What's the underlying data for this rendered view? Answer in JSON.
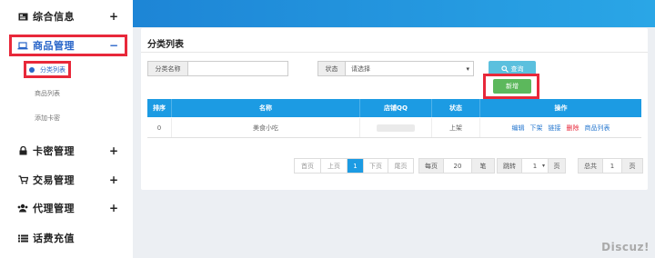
{
  "sidebar": {
    "items": [
      {
        "icon": "id-card-icon",
        "label": "综合信息",
        "toggle": "+"
      },
      {
        "icon": "laptop-icon",
        "label": "商品管理",
        "toggle": "−"
      },
      {
        "icon": "lock-icon",
        "label": "卡密管理",
        "toggle": "+"
      },
      {
        "icon": "cart-icon",
        "label": "交易管理",
        "toggle": "+"
      },
      {
        "icon": "group-icon",
        "label": "代理管理",
        "toggle": "+"
      },
      {
        "icon": "list-icon",
        "label": "话费充值",
        "toggle": ""
      }
    ],
    "sub_items": [
      "分类列表",
      "商品列表",
      "添加卡密"
    ]
  },
  "panel": {
    "title": "分类列表"
  },
  "filters": {
    "name_label": "分类名称",
    "name_value": "",
    "status_label": "状态",
    "status_value": "请选择",
    "search_label": "查询",
    "add_label": "新增"
  },
  "table": {
    "headers": [
      "排序",
      "名称",
      "店铺QQ",
      "状态",
      "操作"
    ],
    "row": {
      "order": "0",
      "name": "美食小吃",
      "qq": "",
      "status": "上架"
    },
    "actions": [
      "编辑",
      "下架",
      "链接",
      "删除",
      "商品列表"
    ]
  },
  "pagination": {
    "first": "首页",
    "prev": "上页",
    "current": "1",
    "next": "下页",
    "last": "尾页",
    "per_page_label": "每页",
    "per_page_value": "20",
    "per_page_unit": "笔",
    "jump_label": "跳转",
    "jump_value": "1",
    "jump_unit": "页",
    "total_label": "总共",
    "total_value": "1",
    "total_unit": "页"
  },
  "watermark": "Discuz!"
}
